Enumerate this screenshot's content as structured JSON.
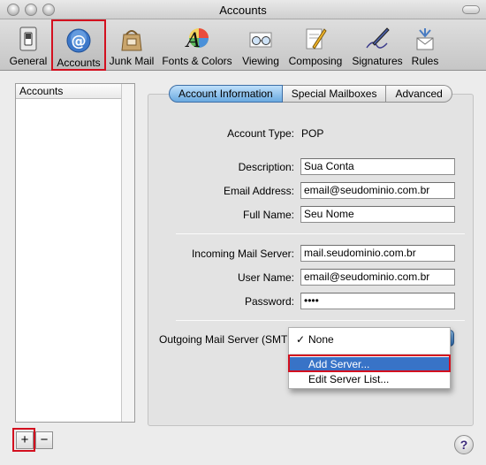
{
  "window": {
    "title": "Accounts"
  },
  "toolbar": {
    "items": [
      {
        "label": "General",
        "icon": "light-switch-icon"
      },
      {
        "label": "Accounts",
        "icon": "at-sign-icon",
        "selected": true
      },
      {
        "label": "Junk Mail",
        "icon": "junk-mail-bag-icon"
      },
      {
        "label": "Fonts & Colors",
        "icon": "color-font-icon"
      },
      {
        "label": "Viewing",
        "icon": "glasses-icon"
      },
      {
        "label": "Composing",
        "icon": "pencil-paper-icon"
      },
      {
        "label": "Signatures",
        "icon": "pen-signature-icon"
      },
      {
        "label": "Rules",
        "icon": "rules-envelope-icon"
      }
    ]
  },
  "accounts_list": {
    "header": "Accounts",
    "add_label": "+",
    "remove_label": "−"
  },
  "tabs": [
    "Account Information",
    "Special Mailboxes",
    "Advanced"
  ],
  "form": {
    "account_type_label": "Account Type:",
    "account_type_value": "POP",
    "description_label": "Description:",
    "description_value": "Sua Conta",
    "email_label": "Email Address:",
    "email_value": "email@seudominio.com.br",
    "fullname_label": "Full Name:",
    "fullname_value": "Seu Nome",
    "incoming_label": "Incoming Mail Server:",
    "incoming_value": "mail.seudominio.com.br",
    "username_label": "User Name:",
    "username_value": "email@seudominio.com.br",
    "password_label": "Password:",
    "password_value": "••••",
    "outgoing_label": "Outgoing Mail Server (SMTP):"
  },
  "smtp_menu": {
    "check": "✓",
    "items": [
      "None",
      "Add Server...",
      "Edit Server List..."
    ]
  },
  "help_label": "?",
  "colors": {
    "highlight_red": "#d3101f",
    "selection_blue": "#3873c7"
  }
}
